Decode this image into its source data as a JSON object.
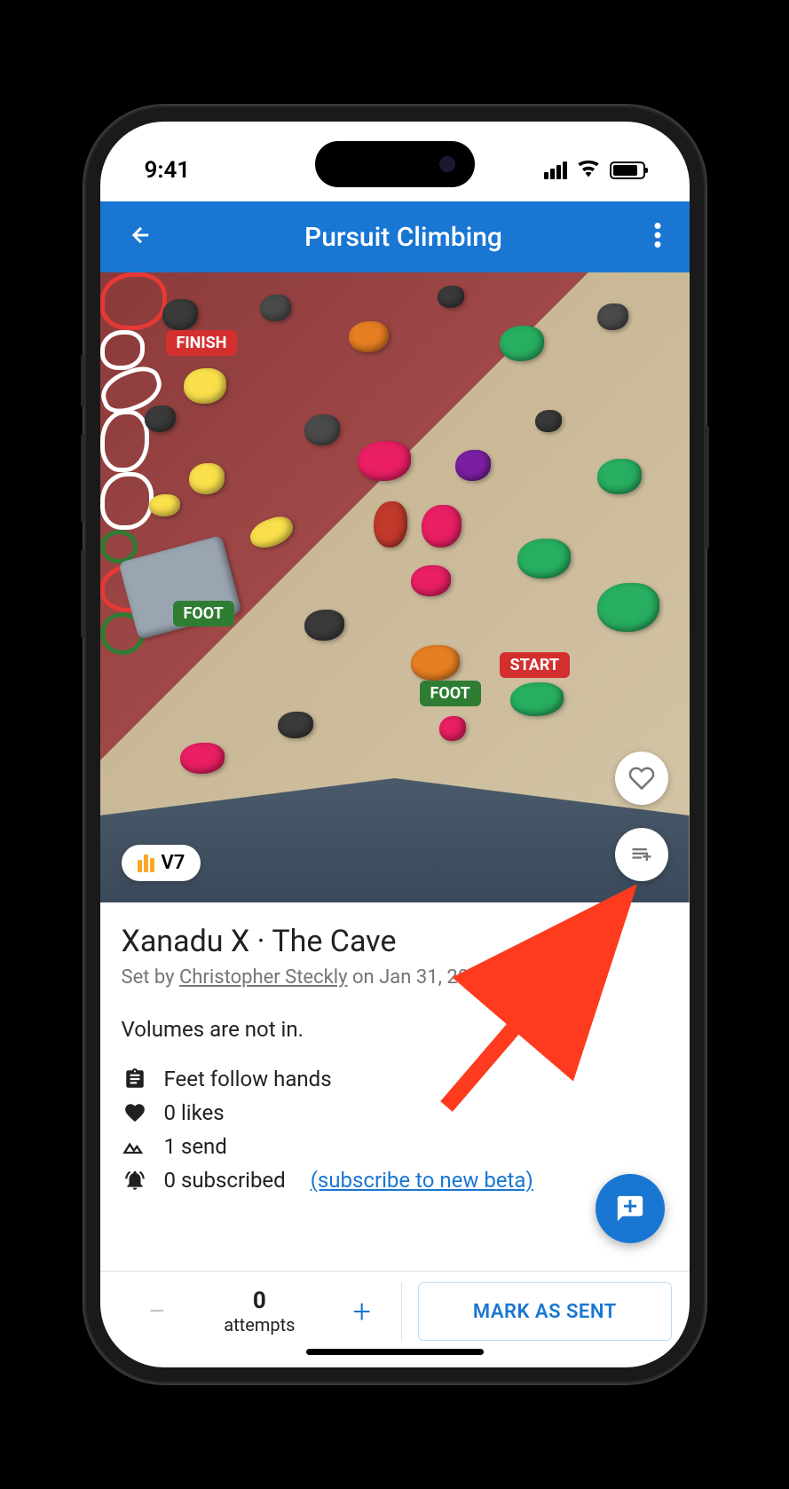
{
  "status": {
    "time": "9:41"
  },
  "appbar": {
    "title": "Pursuit Climbing"
  },
  "photo": {
    "tags": {
      "finish": "FINISH",
      "start": "START",
      "foot": "FOOT"
    },
    "grade": "V7"
  },
  "route": {
    "title": "Xanadu X · The Cave",
    "set_by_prefix": "Set by ",
    "setter": "Christopher Steckly",
    "set_date_suffix": " on Jan 31, 2025",
    "description": "Volumes are not in."
  },
  "stats": {
    "feet": "Feet follow hands",
    "likes": "0 likes",
    "sends": "1 send",
    "subscribed": "0 subscribed",
    "subscribe_link": "(subscribe to new beta)"
  },
  "attempts": {
    "count": "0",
    "label": "attempts"
  },
  "actions": {
    "mark_sent": "MARK AS SENT"
  }
}
